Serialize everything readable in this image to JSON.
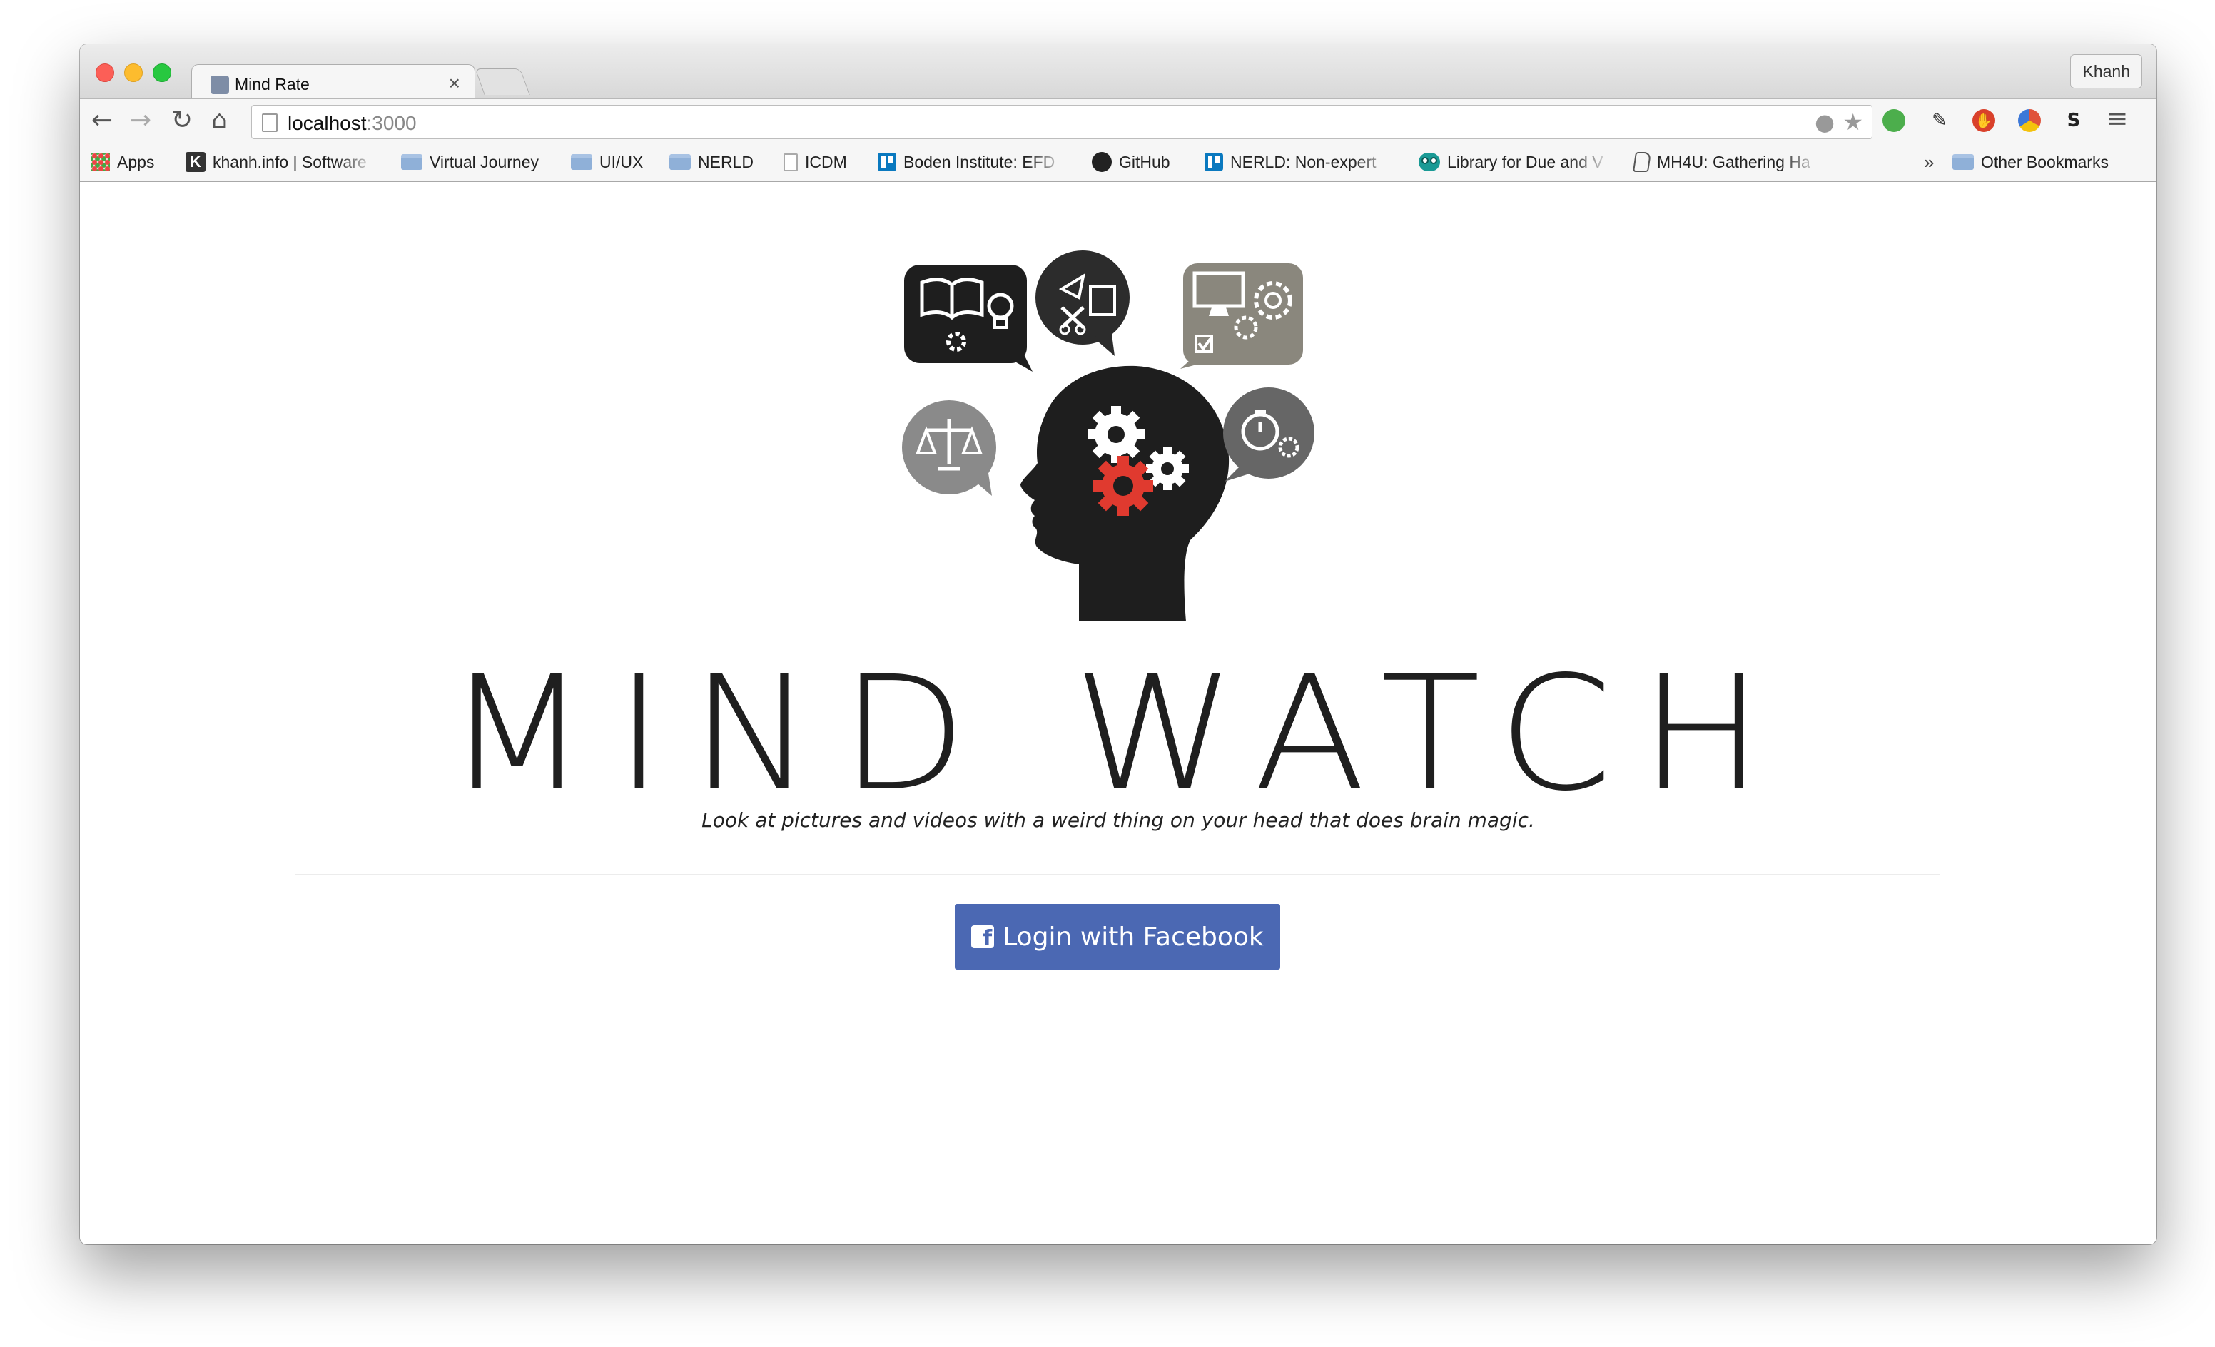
{
  "browser": {
    "tab_title": "Mind Rate",
    "tab_close": "×",
    "profile_name": "Khanh",
    "url_host": "localhost",
    "url_port": ":3000",
    "nav": {
      "back": "←",
      "forward": "→",
      "reload": "↻",
      "home": "⌂"
    },
    "menu_icon": "≡",
    "bookmarks": [
      {
        "label": "Apps",
        "icon": "apps-grid-icon"
      },
      {
        "label": "khanh.info | Software",
        "icon": "k-site-icon"
      },
      {
        "label": "Virtual Journey",
        "icon": "folder-icon"
      },
      {
        "label": "UI/UX",
        "icon": "folder-icon"
      },
      {
        "label": "NERLD",
        "icon": "folder-icon"
      },
      {
        "label": "ICDM",
        "icon": "page-icon"
      },
      {
        "label": "Boden Institute: EFD",
        "icon": "trello-icon"
      },
      {
        "label": "GitHub",
        "icon": "github-icon"
      },
      {
        "label": "NERLD: Non-expert",
        "icon": "trello-icon"
      },
      {
        "label": "Library for Due and V",
        "icon": "tripadvisor-owl-icon"
      },
      {
        "label": "MH4U: Gathering Ha",
        "icon": "mh-icon"
      }
    ],
    "overflow_chevron": "»",
    "other_bookmarks": "Other Bookmarks",
    "brand_colors": {
      "facebook": "#4b68b3",
      "gear_red": "#e03a2f"
    }
  },
  "page": {
    "brand_title": "MIND WATCH",
    "tagline": "Look at pictures and videos with a weird thing on your head that does brain magic.",
    "login_button": "Login with Facebook",
    "facebook_glyph": "f"
  }
}
